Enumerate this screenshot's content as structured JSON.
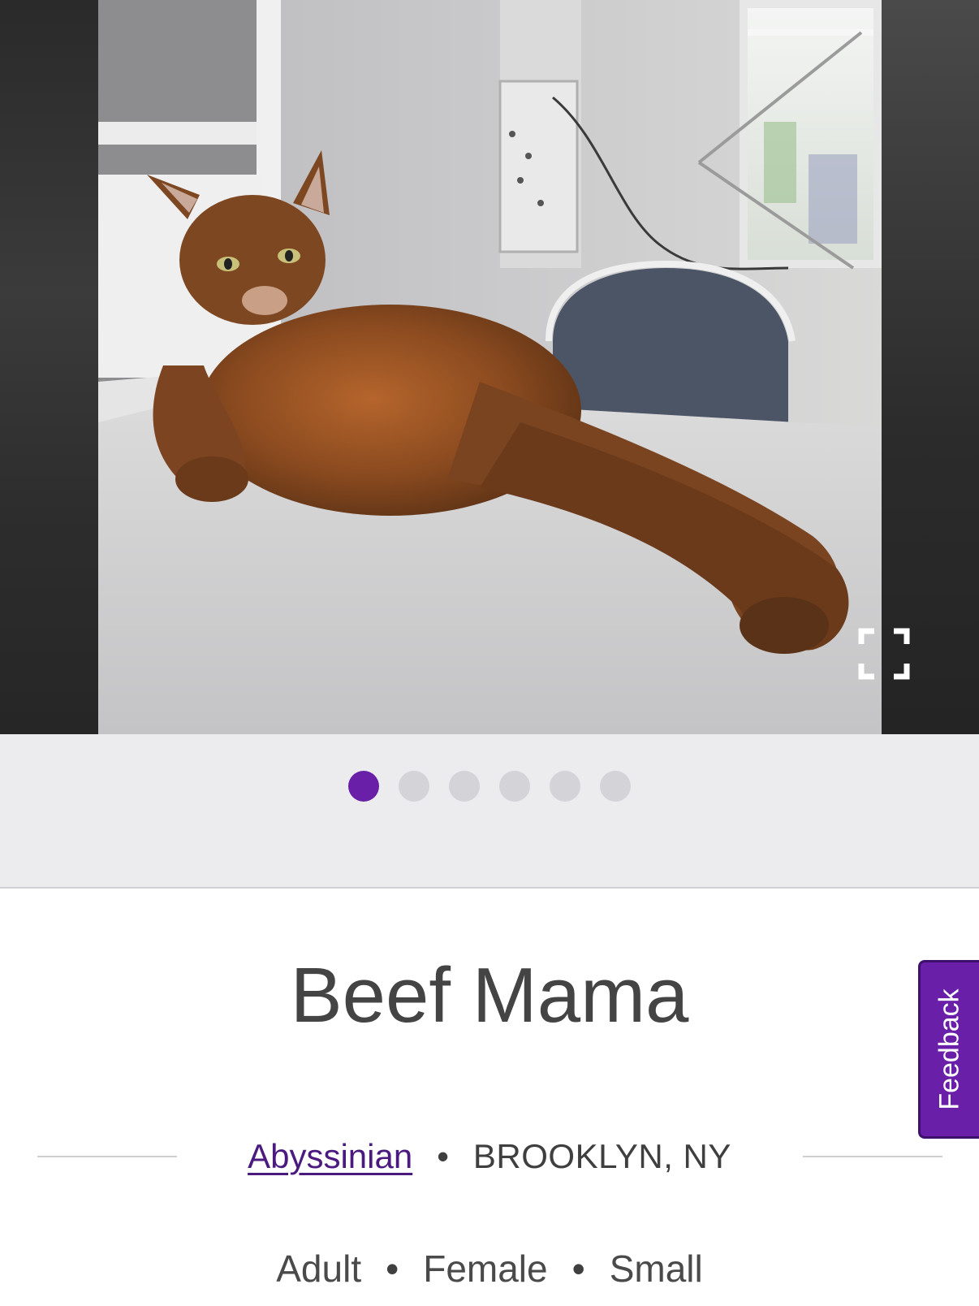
{
  "carousel": {
    "photo_count": 6,
    "active_index": 0,
    "main_photo_description_icon": "cat-photo",
    "fullscreen_icon": "fullscreen-icon"
  },
  "pet": {
    "name": "Beef Mama",
    "breed": "Abyssinian",
    "location": "BROOKLYN, NY",
    "age": "Adult",
    "gender": "Female",
    "size": "Small"
  },
  "separator": "•",
  "feedback": {
    "label": "Feedback"
  },
  "colors": {
    "accent": "#6a1fa8",
    "link": "#4b1a7f",
    "text": "#444444",
    "strip_bg": "#ececef"
  }
}
